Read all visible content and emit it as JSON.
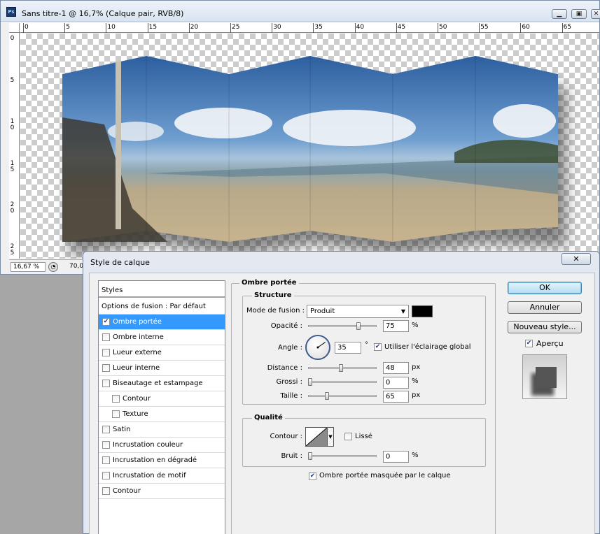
{
  "document": {
    "title": "Sans titre-1 @ 16,7% (Calque pair, RVB/8)",
    "app_icon": "Ps",
    "window_buttons": [
      "minimize-icon",
      "restore-icon",
      "close-icon"
    ],
    "ruler_h_labels": [
      "0",
      "5",
      "10",
      "15",
      "20",
      "25",
      "30",
      "35",
      "40",
      "45",
      "50",
      "55",
      "60",
      "65"
    ],
    "ruler_v_labels": [
      "0",
      "5",
      "10",
      "15",
      "20",
      "25"
    ],
    "zoom": "16,67 %",
    "status_text": "70,0"
  },
  "dialog": {
    "title": "Style de calque",
    "close_symbol": "✕",
    "styles_header": "Styles",
    "blending_options": "Options de fusion : Par défaut",
    "styles": [
      {
        "label": "Ombre portée",
        "checked": true,
        "selected": true,
        "indent": false
      },
      {
        "label": "Ombre interne",
        "checked": false,
        "selected": false,
        "indent": false
      },
      {
        "label": "Lueur externe",
        "checked": false,
        "selected": false,
        "indent": false
      },
      {
        "label": "Lueur interne",
        "checked": false,
        "selected": false,
        "indent": false
      },
      {
        "label": "Biseautage et estampage",
        "checked": false,
        "selected": false,
        "indent": false
      },
      {
        "label": "Contour",
        "checked": false,
        "selected": false,
        "indent": true
      },
      {
        "label": "Texture",
        "checked": false,
        "selected": false,
        "indent": true
      },
      {
        "label": "Satin",
        "checked": false,
        "selected": false,
        "indent": false
      },
      {
        "label": "Incrustation couleur",
        "checked": false,
        "selected": false,
        "indent": false
      },
      {
        "label": "Incrustation en dégradé",
        "checked": false,
        "selected": false,
        "indent": false
      },
      {
        "label": "Incrustation de motif",
        "checked": false,
        "selected": false,
        "indent": false
      },
      {
        "label": "Contour",
        "checked": false,
        "selected": false,
        "indent": false
      }
    ],
    "panel_title": "Ombre portée",
    "structure": {
      "title": "Structure",
      "blend_mode_label": "Mode de fusion :",
      "blend_mode_value": "Produit",
      "shadow_color": "#000000",
      "opacity_label": "Opacité :",
      "opacity_value": "75",
      "opacity_unit": "%",
      "opacity_fraction": 0.75,
      "angle_label": "Angle :",
      "angle_value": "35",
      "angle_unit": "°",
      "angle_degrees": 35,
      "global_light_label": "Utiliser l'éclairage global",
      "global_light_checked": true,
      "distance_label": "Distance :",
      "distance_value": "48",
      "distance_unit": "px",
      "distance_fraction": 0.48,
      "spread_label": "Grossi :",
      "spread_value": "0",
      "spread_unit": "%",
      "spread_fraction": 0,
      "size_label": "Taille :",
      "size_value": "65",
      "size_unit": "px",
      "size_fraction": 0.26
    },
    "quality": {
      "title": "Qualité",
      "contour_label": "Contour :",
      "antialias_label": "Lissé",
      "antialias_checked": false,
      "noise_label": "Bruit :",
      "noise_value": "0",
      "noise_unit": "%",
      "noise_fraction": 0
    },
    "knockout_label": "Ombre portée masquée par le calque",
    "knockout_checked": true,
    "buttons": {
      "ok": "OK",
      "cancel": "Annuler",
      "new_style": "Nouveau style...",
      "preview_label": "Aperçu",
      "preview_checked": true
    }
  }
}
